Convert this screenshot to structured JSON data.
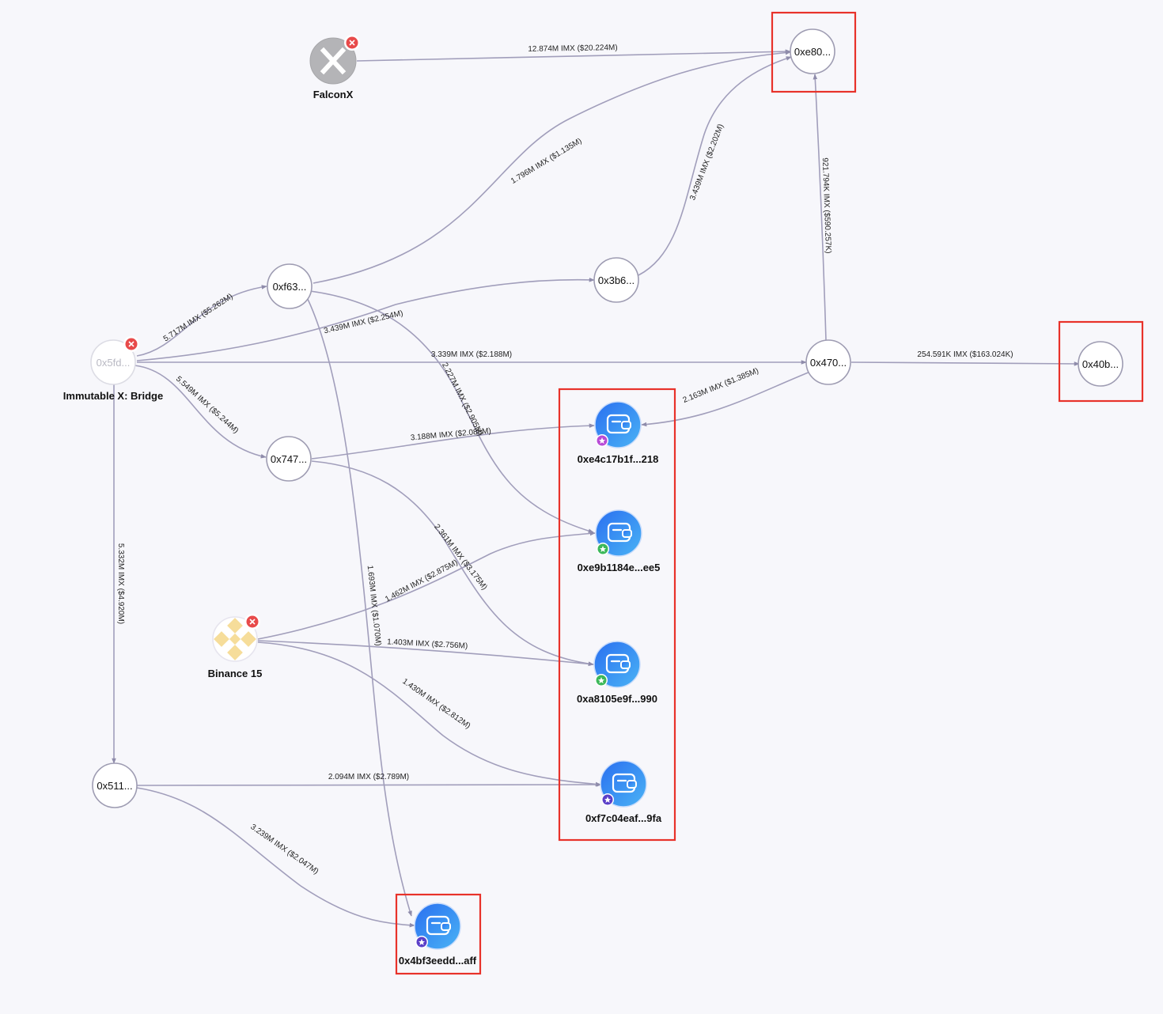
{
  "nodes": {
    "falconx": {
      "label": "FalconX",
      "icon": "falconx-logo-icon",
      "status": "remove-badge"
    },
    "bridge": {
      "text": "0x5fd...",
      "label": "Immutable X: Bridge",
      "status": "remove-badge"
    },
    "binance": {
      "label": "Binance 15",
      "icon": "binance-logo-icon",
      "status": "remove-badge"
    },
    "n0xe80": {
      "text": "0xe80..."
    },
    "n0xf63": {
      "text": "0xf63..."
    },
    "n0x3b6": {
      "text": "0x3b6..."
    },
    "n0x470": {
      "text": "0x470..."
    },
    "n0x40b": {
      "text": "0x40b..."
    },
    "n0x747": {
      "text": "0x747..."
    },
    "n0x511": {
      "text": "0x511..."
    },
    "wallet_e4c": {
      "label": "0xe4c17b1f...218",
      "icon": "wallet-icon",
      "badge_color": "#b84bd6"
    },
    "wallet_e9b": {
      "label": "0xe9b1184e...ee5",
      "icon": "wallet-icon",
      "badge_color": "#3cb85a"
    },
    "wallet_a81": {
      "label": "0xa8105e9f...990",
      "icon": "wallet-icon",
      "badge_color": "#3cb85a"
    },
    "wallet_f7c": {
      "label": "0xf7c04eaf...9fa",
      "icon": "wallet-icon",
      "badge_color": "#5b3fc8"
    },
    "wallet_4bf": {
      "label": "0x4bf3eedd...aff",
      "icon": "wallet-icon",
      "badge_color": "#5b3fc8"
    }
  },
  "edges": {
    "falconx_e80": "12.874M IMX ($20.224M)",
    "f63_e80": "1.796M IMX ($1.135M)",
    "b3b6_e80": "3.439M IMX ($2.202M)",
    "n470_e80": "921.794K IMX ($590.257K)",
    "bridge_f63": "5.717M IMX ($5.262M)",
    "bridge_3b6": "3.439M IMX ($2.254M)",
    "bridge_470": "3.339M IMX ($2.188M)",
    "n470_40b": "254.591K IMX ($163.024K)",
    "bridge_747": "5.549M IMX ($5.244M)",
    "f63_e9b": "2.227M IMX ($2.905M)",
    "n470_e4c": "2.163M IMX ($1.385M)",
    "n747_e4c": "3.188M IMX ($2.085M)",
    "n747_a81": "2.361M IMX ($3.175M)",
    "binance_e9b": "1.462M IMX ($2.875M)",
    "f63_4bf": "1.693M IMX ($1.070M)",
    "binance_a81": "1.403M IMX ($2.756M)",
    "binance_f7c": "1.430M IMX ($2.812M)",
    "bridge_511": "5.332M IMX ($4.920M)",
    "n511_f7c": "2.094M IMX ($2.789M)",
    "n511_4bf": "3.239M IMX ($2.047M)"
  },
  "colors": {
    "edge": "#a19ebb",
    "node_border": "#9e9cb2",
    "highlight": "#e8322a",
    "wallet_gradient_start": "#2a6ff0",
    "wallet_gradient_end": "#4ab3f5",
    "remove_badge": "#e84a4a",
    "background": "#f7f7fb"
  }
}
